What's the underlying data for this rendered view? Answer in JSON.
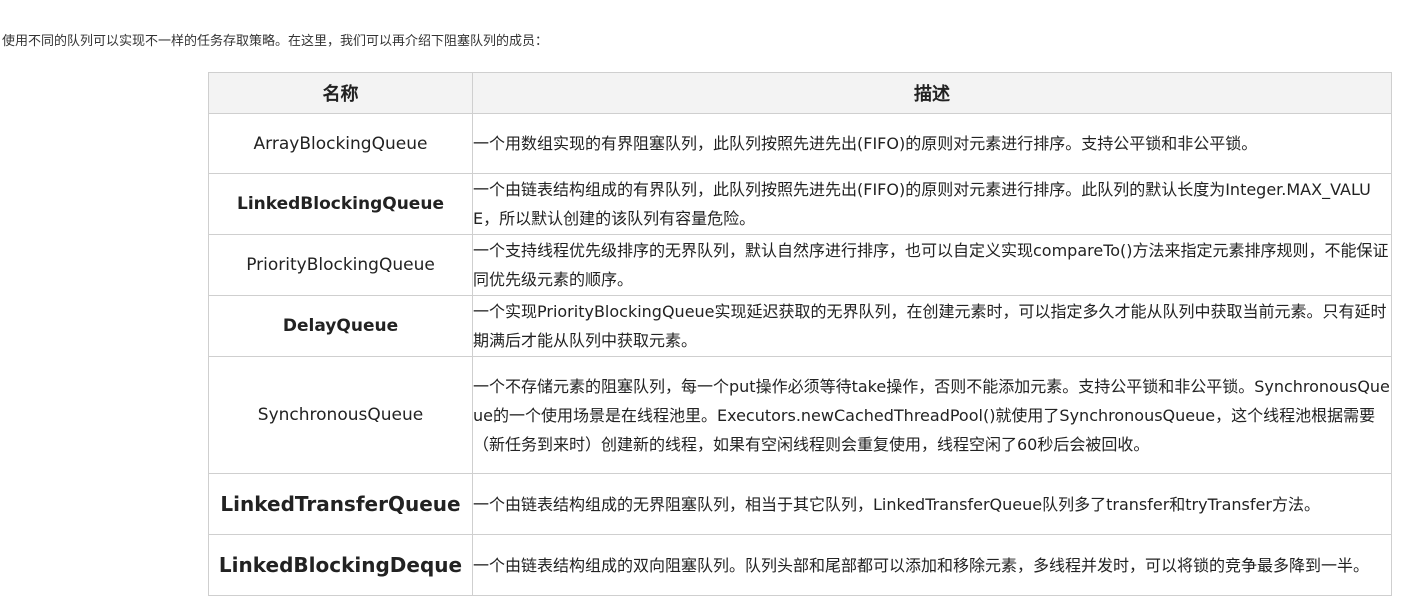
{
  "intro_text": "使用不同的队列可以实现不一样的任务存取策略。在这里，我们可以再介绍下阻塞队列的成员：",
  "table": {
    "headers": {
      "name": "名称",
      "description": "描述"
    },
    "rows": [
      {
        "name": "ArrayBlockingQueue",
        "description": "一个用数组实现的有界阻塞队列，此队列按照先进先出(FIFO)的原则对元素进行排序。支持公平锁和非公平锁。"
      },
      {
        "name": "LinkedBlockingQueue",
        "description": "一个由链表结构组成的有界队列，此队列按照先进先出(FIFO)的原则对元素进行排序。此队列的默认长度为Integer.MAX_VALUE，所以默认创建的该队列有容量危险。"
      },
      {
        "name": "PriorityBlockingQueue",
        "description": "一个支持线程优先级排序的无界队列，默认自然序进行排序，也可以自定义实现compareTo()方法来指定元素排序规则，不能保证同优先级元素的顺序。"
      },
      {
        "name": "DelayQueue",
        "description": "一个实现PriorityBlockingQueue实现延迟获取的无界队列，在创建元素时，可以指定多久才能从队列中获取当前元素。只有延时期满后才能从队列中获取元素。"
      },
      {
        "name": "SynchronousQueue",
        "description": "一个不存储元素的阻塞队列，每一个put操作必须等待take操作，否则不能添加元素。支持公平锁和非公平锁。SynchronousQueue的一个使用场景是在线程池里。Executors.newCachedThreadPool()就使用了SynchronousQueue，这个线程池根据需要（新任务到来时）创建新的线程，如果有空闲线程则会重复使用，线程空闲了60秒后会被回收。"
      },
      {
        "name": "LinkedTransferQueue",
        "description": "一个由链表结构组成的无界阻塞队列，相当于其它队列，LinkedTransferQueue队列多了transfer和tryTransfer方法。"
      },
      {
        "name": "LinkedBlockingDeque",
        "description": "一个由链表结构组成的双向阻塞队列。队列头部和尾部都可以添加和移除元素，多线程并发时，可以将锁的竞争最多降到一半。"
      }
    ]
  }
}
